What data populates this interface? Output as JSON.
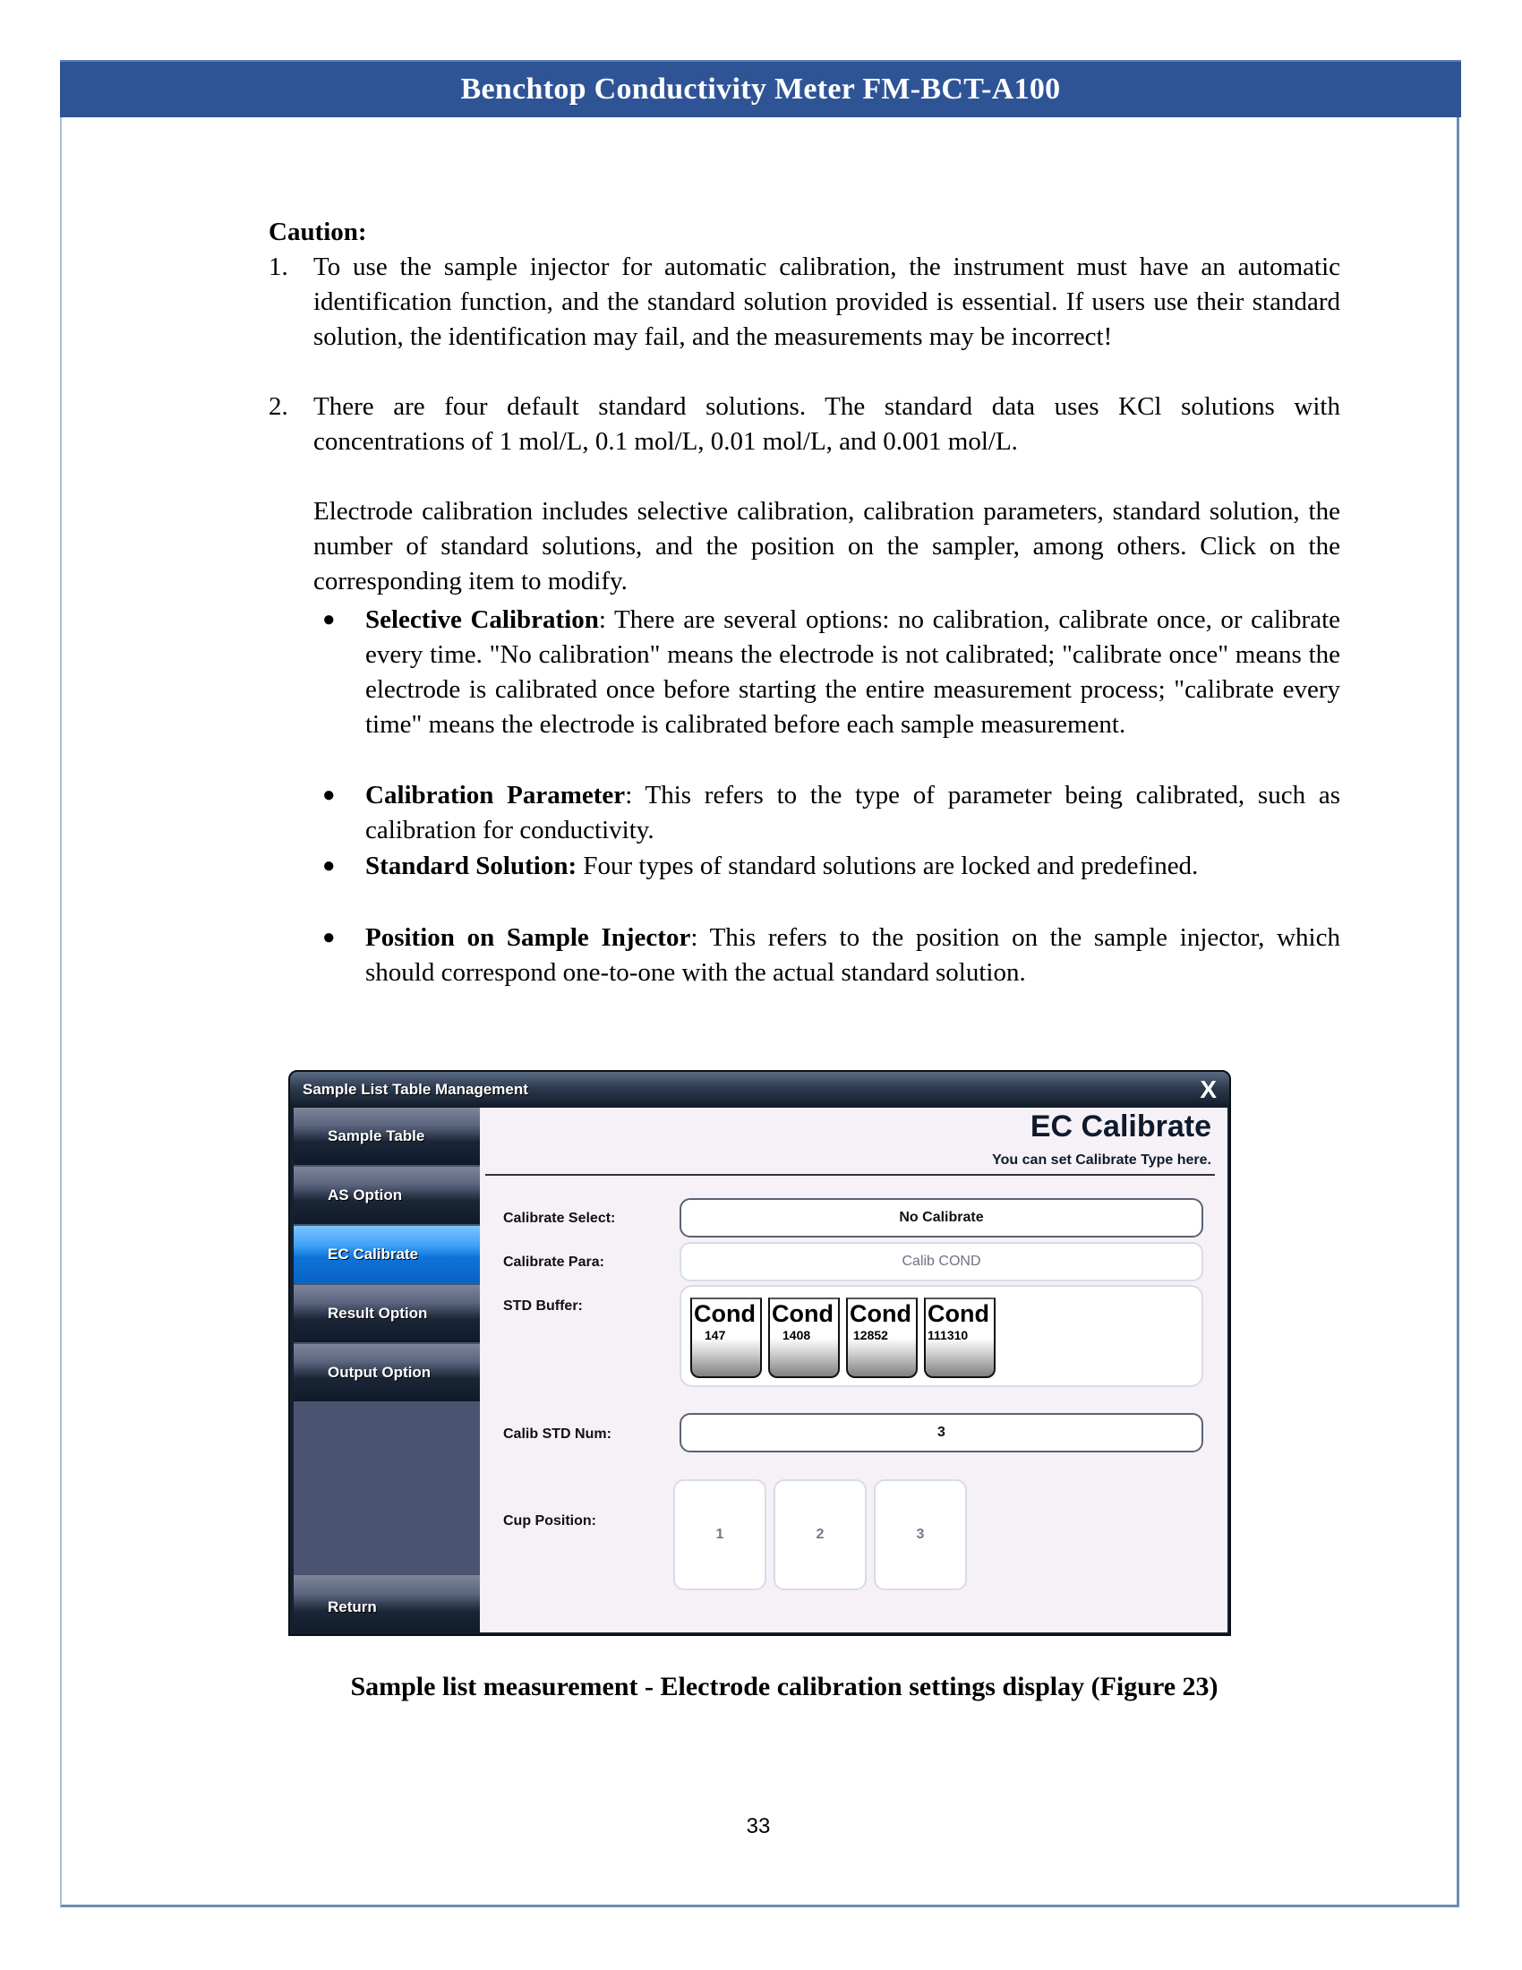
{
  "header": {
    "title": "Benchtop Conductivity Meter FM-BCT-A100"
  },
  "caution": {
    "heading": "Caution:",
    "items": [
      {
        "num": "1.",
        "text": "To use the sample injector for automatic calibration, the instrument must have an automatic identification function, and the standard solution provided is essential. If users use their standard solution, the identification may fail, and the measurements may be incorrect!"
      },
      {
        "num": "2.",
        "text": "There are four default standard solutions. The standard data uses KCl solutions with concentrations of 1 mol/L, 0.1 mol/L, 0.01 mol/L, and 0.001 mol/L."
      }
    ]
  },
  "intro_paragraph": "Electrode calibration includes selective calibration, calibration parameters, standard solution, the number of standard solutions, and the position on the sampler, among others. Click on the corresponding item to modify.",
  "bullets": [
    {
      "term": "Selective Calibration",
      "sep": ":",
      "text": " There are several options: no calibration, calibrate once, or calibrate every time. \"No calibration\" means the electrode is not calibrated; \"calibrate once\" means the electrode is calibrated once before starting the entire measurement process; \"calibrate every time\" means the electrode is calibrated before each sample measurement."
    },
    {
      "term": "Calibration Parameter",
      "sep": ":",
      "text": " This refers to the type of parameter being calibrated, such as calibration for conductivity."
    },
    {
      "term": "Standard Solution:",
      "sep": "",
      "text": " Four types of standard solutions are locked and predefined."
    },
    {
      "term": "Position on Sample Injector",
      "sep": ":",
      "text": " This refers to the position on the sample injector, which should correspond one-to-one with the actual standard solution."
    }
  ],
  "window": {
    "title": "Sample List Table Management",
    "close_glyph": "X",
    "sidebar": {
      "items": [
        {
          "label": "Sample Table",
          "active": false
        },
        {
          "label": "AS Option",
          "active": false
        },
        {
          "label": "EC Calibrate",
          "active": true
        },
        {
          "label": "Result Option",
          "active": false
        },
        {
          "label": "Output Option",
          "active": false
        }
      ],
      "return_label": "Return"
    },
    "panel": {
      "title": "EC Calibrate",
      "subtitle": "You can set Calibrate Type here.",
      "calibrate_select_label": "Calibrate Select:",
      "calibrate_select_value": "No Calibrate",
      "calibrate_para_label": "Calibrate Para:",
      "calibrate_para_value": "Calib COND",
      "std_buffer_label": "STD Buffer:",
      "std_buffers": [
        {
          "name": "Cond",
          "value": "147"
        },
        {
          "name": "Cond",
          "value": "1408"
        },
        {
          "name": "Cond",
          "value": "12852"
        },
        {
          "name": "Cond",
          "value": "111310"
        }
      ],
      "calib_std_num_label": "Calib STD Num:",
      "calib_std_num_value": "3",
      "cup_position_label": "Cup Position:",
      "cup_positions": [
        "1",
        "2",
        "3"
      ]
    }
  },
  "caption": "Sample list measurement - Electrode calibration settings display (Figure 23)",
  "page_number": "33",
  "colors": {
    "header_bar": "#2f5496",
    "active_tab": "#0d73d9"
  }
}
